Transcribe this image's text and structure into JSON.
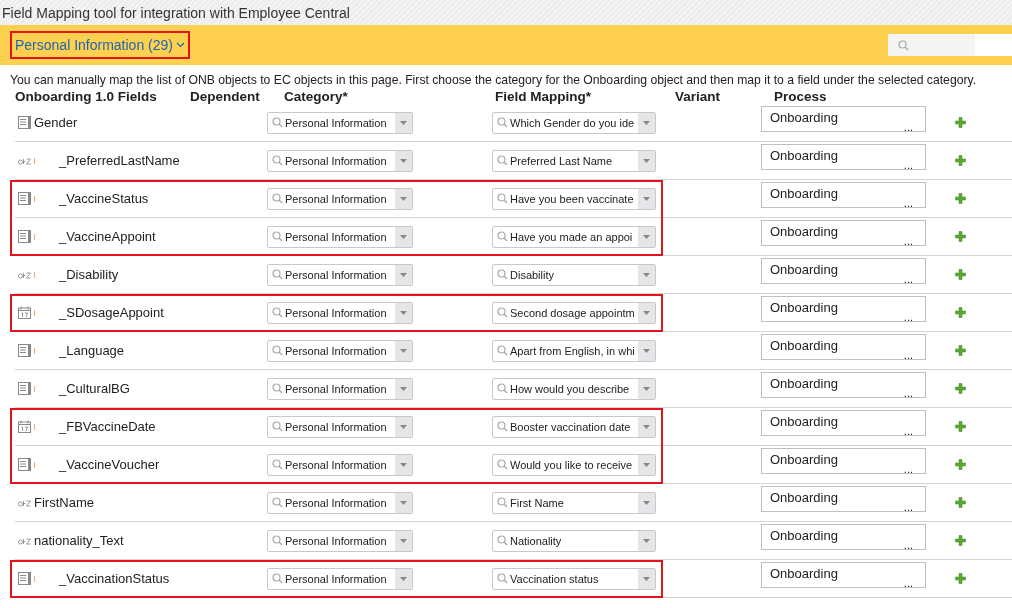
{
  "window": {
    "title": "Field Mapping tool for integration with Employee Central"
  },
  "category_bar": {
    "label": "Personal Information (29)",
    "highlighted": true
  },
  "description": "You can manually map the list of ONB objects to EC objects in this page. First choose the category for the Onboarding object and then map it to a field under the selected category.",
  "columns": [
    "Onboarding 1.0 Fields",
    "Dependent",
    "Category*",
    "Field Mapping*",
    "Variant",
    "Process"
  ],
  "rows": [
    {
      "kind": "text",
      "custom": false,
      "name": "Gender",
      "category": "Personal Information",
      "mapping": "Which Gender do you ide",
      "process": "Onboarding",
      "more": "...",
      "highlighted": false
    },
    {
      "kind": "string",
      "custom": true,
      "name": "_PreferredLastName",
      "category": "Personal Information",
      "mapping": "Preferred Last Name",
      "process": "Onboarding",
      "more": "...",
      "highlighted": false
    },
    {
      "kind": "text",
      "custom": true,
      "name": "_VaccineStatus",
      "category": "Personal Information",
      "mapping": "Have you been vaccinate",
      "process": "Onboarding",
      "more": "...",
      "highlighted": true
    },
    {
      "kind": "text",
      "custom": true,
      "name": "_VaccineAppoint",
      "category": "Personal Information",
      "mapping": "Have you made an appoi",
      "process": "Onboarding",
      "more": "...",
      "highlighted": true
    },
    {
      "kind": "string",
      "custom": true,
      "name": "_Disability",
      "category": "Personal Information",
      "mapping": "Disability",
      "process": "Onboarding",
      "more": "...",
      "highlighted": false
    },
    {
      "kind": "date",
      "custom": true,
      "name": "_SDosageAppoint",
      "category": "Personal Information",
      "mapping": "Second dosage appointm",
      "process": "Onboarding",
      "more": "...",
      "highlighted": true
    },
    {
      "kind": "text",
      "custom": true,
      "name": "_Language",
      "category": "Personal Information",
      "mapping": "Apart from English, in whi",
      "process": "Onboarding",
      "more": "...",
      "highlighted": false
    },
    {
      "kind": "text",
      "custom": true,
      "name": "_CulturalBG",
      "category": "Personal Information",
      "mapping": "How would you describe",
      "process": "Onboarding",
      "more": "...",
      "highlighted": false
    },
    {
      "kind": "date",
      "custom": true,
      "name": "_FBVaccineDate",
      "category": "Personal Information",
      "mapping": "Booster vaccination date",
      "process": "Onboarding",
      "more": "...",
      "highlighted": true
    },
    {
      "kind": "text",
      "custom": true,
      "name": "_VaccineVoucher",
      "category": "Personal Information",
      "mapping": "Would you like to receive",
      "process": "Onboarding",
      "more": "...",
      "highlighted": true
    },
    {
      "kind": "string",
      "custom": false,
      "name": "FirstName",
      "category": "Personal Information",
      "mapping": "First Name",
      "process": "Onboarding",
      "more": "...",
      "highlighted": false
    },
    {
      "kind": "string",
      "custom": false,
      "name": "nationality_Text",
      "category": "Personal Information",
      "mapping": "Nationality",
      "process": "Onboarding",
      "more": "...",
      "highlighted": false
    },
    {
      "kind": "text",
      "custom": true,
      "name": "_VaccinationStatus",
      "category": "Personal Information",
      "mapping": "Vaccination status",
      "process": "Onboarding",
      "more": "...",
      "highlighted": true
    }
  ]
}
